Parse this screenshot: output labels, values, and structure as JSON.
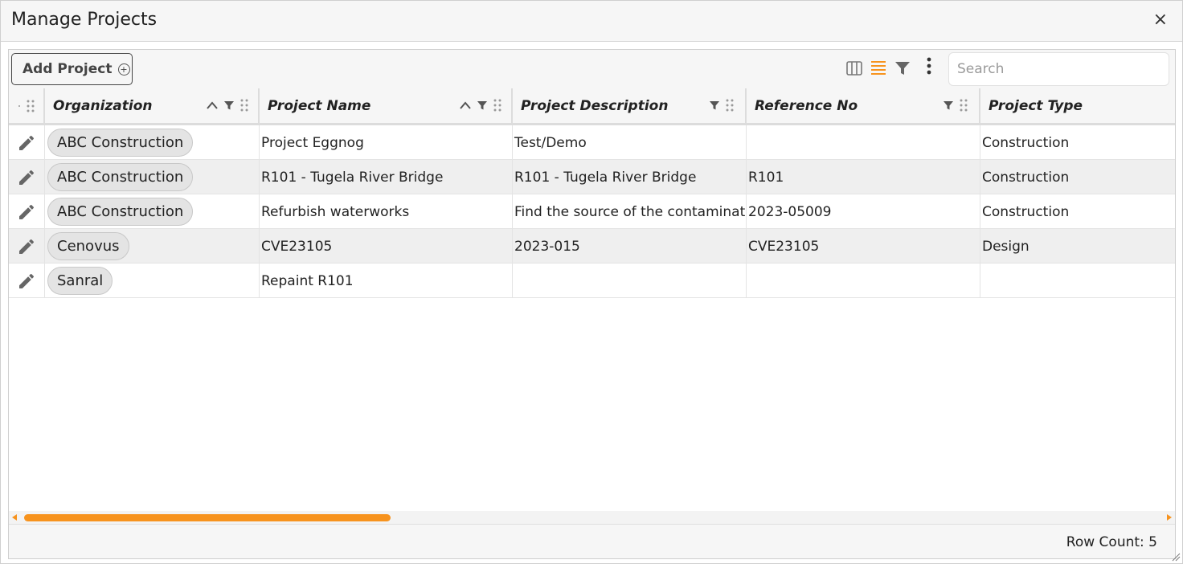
{
  "dialog": {
    "title": "Manage Projects",
    "close_label": "×"
  },
  "toolbar": {
    "add_label": "Add Project",
    "add_icon": "plus-circle-icon",
    "icons": [
      "columns-icon",
      "density-icon",
      "filter-icon",
      "more-vertical-icon"
    ],
    "search_placeholder": "Search",
    "accent_color": "#f7931e"
  },
  "columns": [
    {
      "label": "Organization"
    },
    {
      "label": "Project Name"
    },
    {
      "label": "Project Description"
    },
    {
      "label": "Reference No"
    },
    {
      "label": "Project Type"
    }
  ],
  "rows": [
    {
      "organization": "ABC Construction",
      "name": "Project Eggnog",
      "description": "Test/Demo",
      "reference": "",
      "type": "Construction"
    },
    {
      "organization": "ABC Construction",
      "name": "R101 - Tugela River Bridge",
      "description": "R101 - Tugela River Bridge",
      "reference": "R101",
      "type": "Construction"
    },
    {
      "organization": "ABC Construction",
      "name": "Refurbish waterworks",
      "description": "Find the source of the contaminatio",
      "reference": "2023-05009",
      "type": "Construction"
    },
    {
      "organization": "Cenovus",
      "name": "CVE23105",
      "description": "2023-015",
      "reference": "CVE23105",
      "type": "Design"
    },
    {
      "organization": "Sanral",
      "name": "Repaint R101",
      "description": "",
      "reference": "",
      "type": ""
    }
  ],
  "footer": {
    "row_count": "Row Count: 5"
  }
}
